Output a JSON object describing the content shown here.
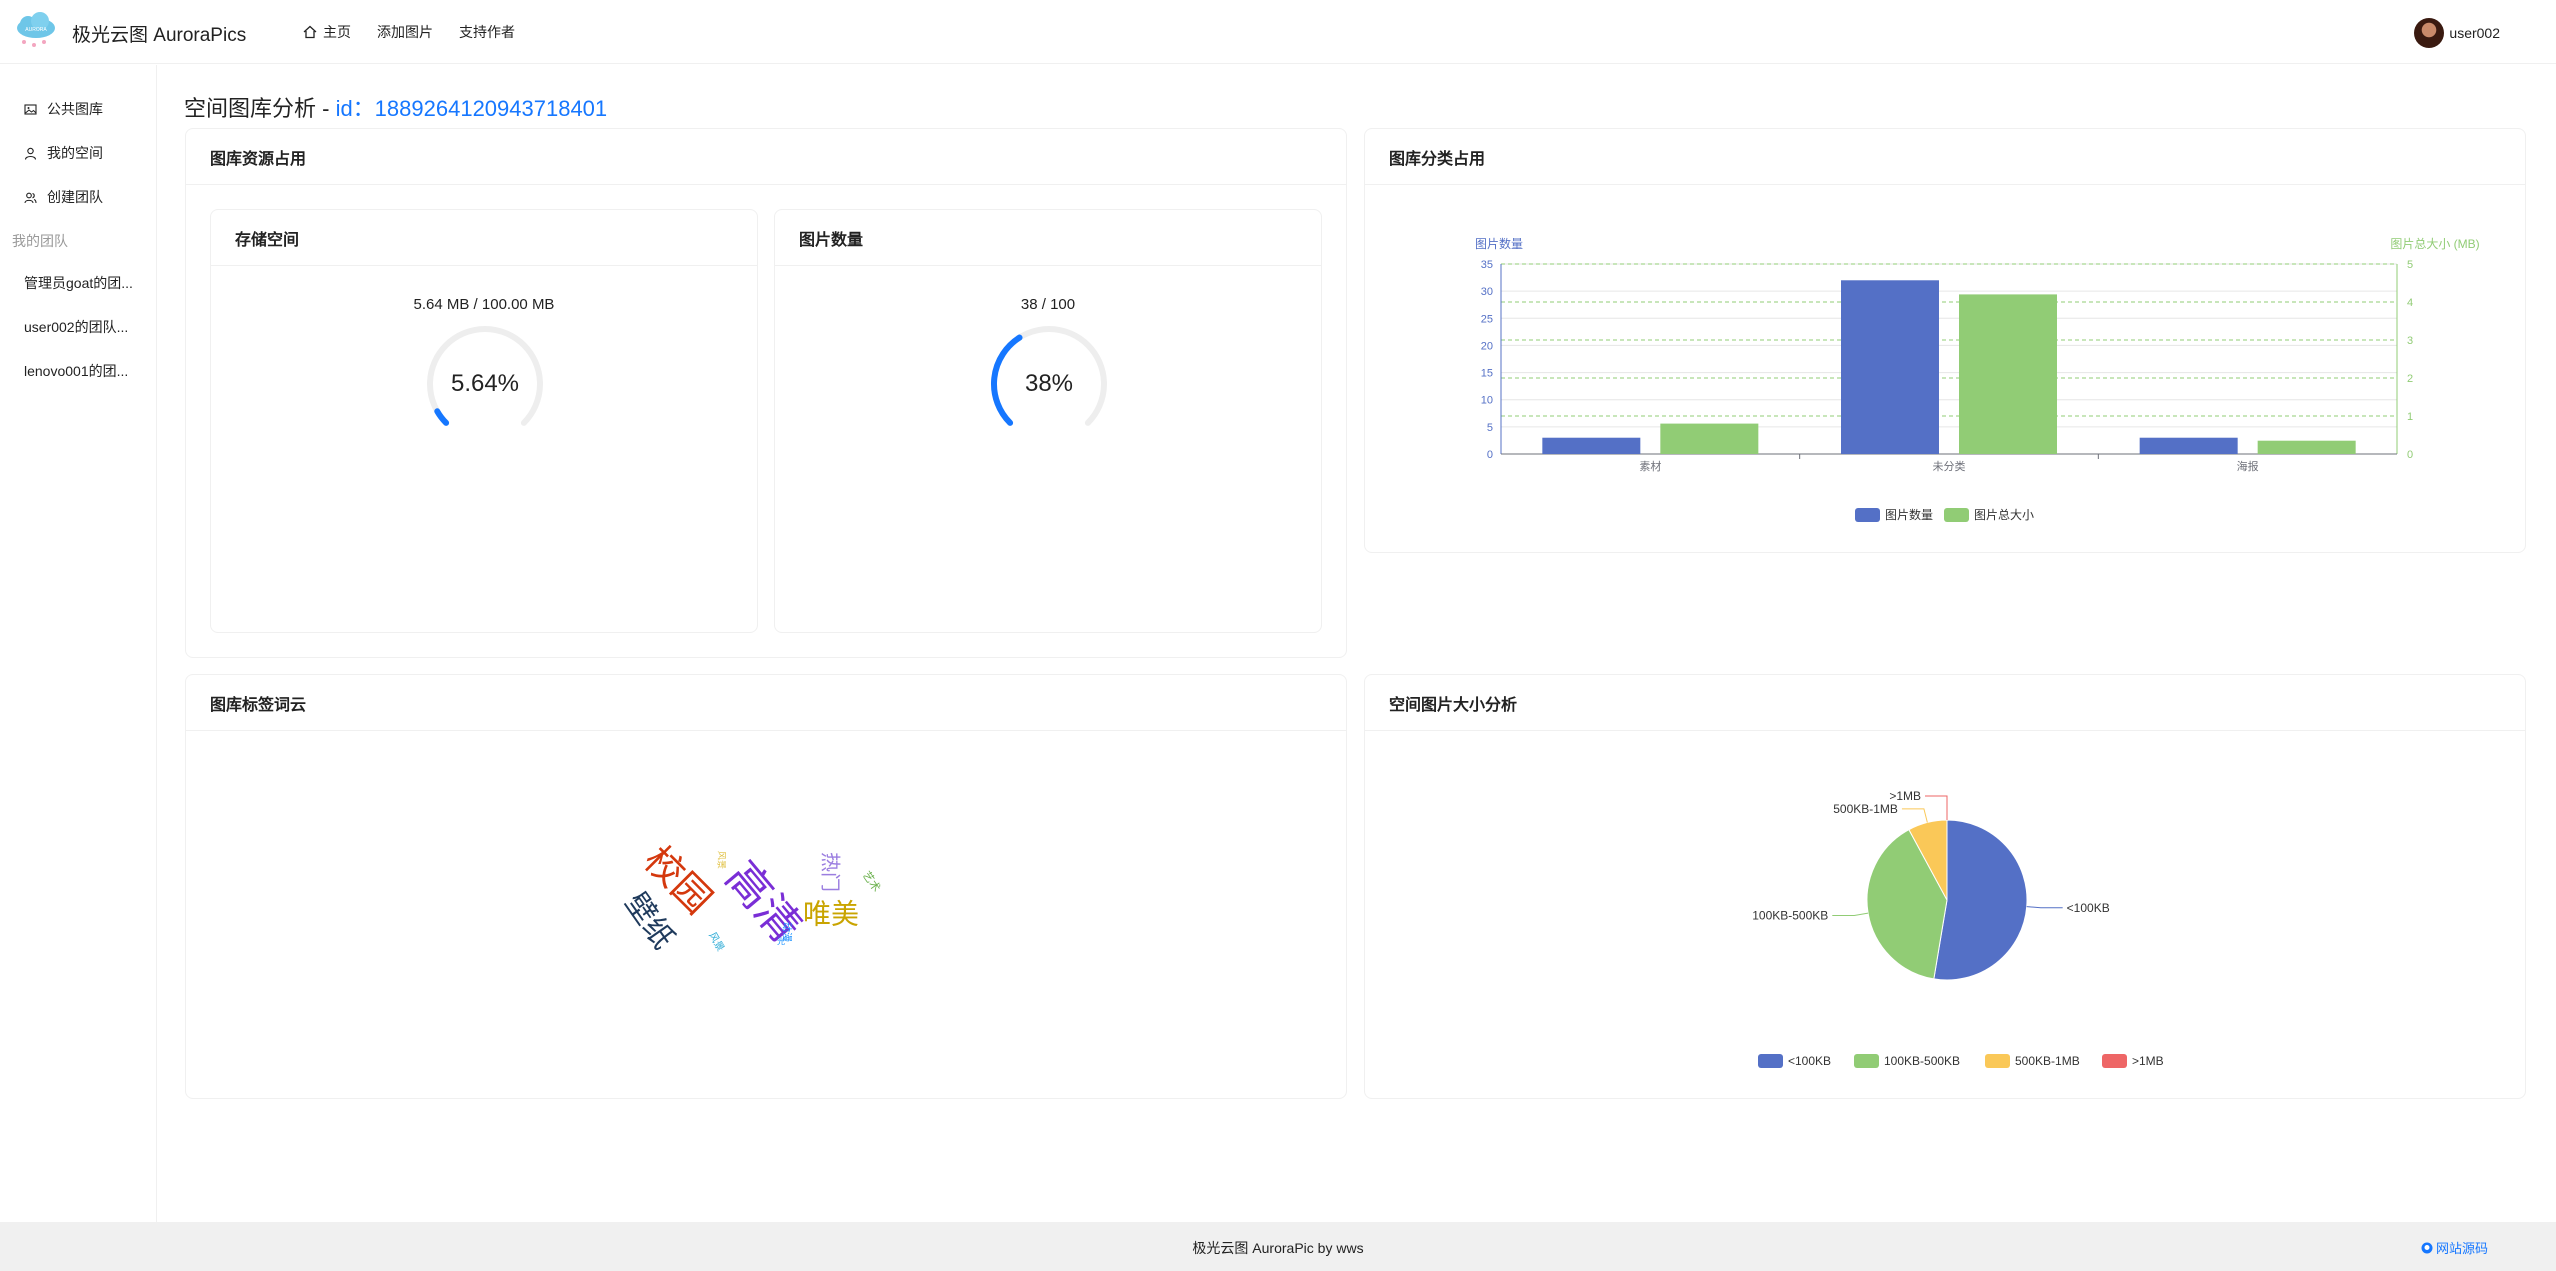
{
  "header": {
    "brand": "极光云图 AuroraPics",
    "nav": [
      {
        "label": "主页",
        "icon": "home-icon"
      },
      {
        "label": "添加图片"
      },
      {
        "label": "支持作者"
      }
    ],
    "user": "user002"
  },
  "sidebar": {
    "items": [
      {
        "label": "公共图库",
        "icon": "picture-icon"
      },
      {
        "label": "我的空间",
        "icon": "user-icon"
      },
      {
        "label": "创建团队",
        "icon": "team-icon"
      }
    ],
    "group_label": "我的团队",
    "teams": [
      "管理员goat的团...",
      "user002的团队...",
      "lenovo001的团..."
    ]
  },
  "page": {
    "title_prefix": "空间图库分析 - ",
    "id_text": "id：1889264120943718401"
  },
  "resource_card": {
    "title": "图库资源占用",
    "storage": {
      "title": "存储空间",
      "usage": "5.64 MB / 100.00 MB",
      "percent_text": "5.64%",
      "percent": 5.64
    },
    "count": {
      "title": "图片数量",
      "usage": "38 / 100",
      "percent_text": "38%",
      "percent": 38
    }
  },
  "category_card": {
    "title": "图库分类占用"
  },
  "tag_card": {
    "title": "图库标签词云",
    "words": [
      {
        "text": "高清",
        "color": "#7a2ed6"
      },
      {
        "text": "校园",
        "color": "#d4380d"
      },
      {
        "text": "壁纸",
        "color": "#1f3a5c"
      },
      {
        "text": "唯美",
        "color": "#c9a400"
      },
      {
        "text": "热门",
        "color": "#9b7ee0"
      },
      {
        "text": "艺术",
        "color": "#6ab04c"
      },
      {
        "text": "动漫",
        "color": "#1890ff"
      },
      {
        "text": "风景",
        "color": "#2dabd6"
      },
      {
        "text": "风景",
        "color": "#e0c040"
      },
      {
        "text": "光",
        "color": "#1890ff"
      }
    ]
  },
  "size_card": {
    "title": "空间图片大小分析"
  },
  "chart_data": [
    {
      "type": "bar",
      "categories": [
        "素材",
        "未分类",
        "海报"
      ],
      "ylabel": "图片数量",
      "ylabel_right": "图片总大小 (MB)",
      "ylim": [
        0,
        35
      ],
      "ylim_right": [
        0,
        5
      ],
      "yticks": [
        0,
        5,
        10,
        15,
        20,
        25,
        30,
        35
      ],
      "yticks_right": [
        0,
        1,
        2,
        3,
        4,
        5
      ],
      "series": [
        {
          "name": "图片数量",
          "values": [
            3,
            32,
            3
          ],
          "color": "#5470c6",
          "axis": "left"
        },
        {
          "name": "图片总大小",
          "values": [
            0.8,
            4.2,
            0.35
          ],
          "color": "#91cc75",
          "axis": "right"
        }
      ],
      "legend": "bottom"
    },
    {
      "type": "pie",
      "labels": [
        "<100KB",
        "100KB-500KB",
        "500KB-1MB",
        ">1MB"
      ],
      "values": [
        20,
        15,
        3,
        0
      ],
      "colors": [
        "#5470c6",
        "#91cc75",
        "#fac858",
        "#ee6666"
      ],
      "legend": "bottom"
    }
  ],
  "footer": {
    "text": "极光云图 AuroraPic by wws",
    "link": "网站源码"
  }
}
